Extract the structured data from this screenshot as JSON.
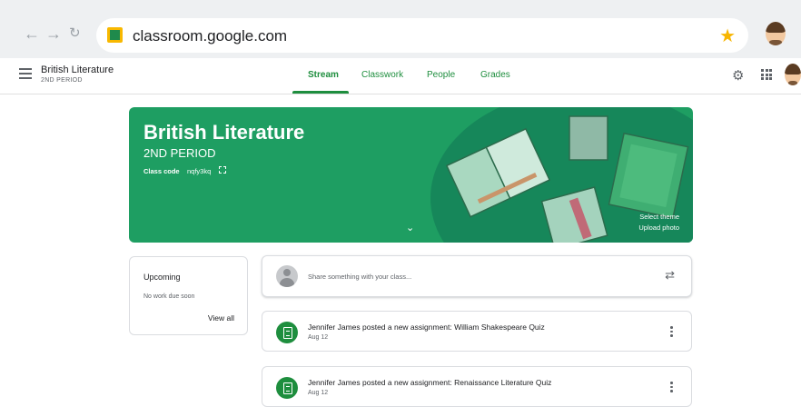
{
  "browser": {
    "url": "classroom.google.com",
    "back_icon": "back-arrow-icon",
    "forward_icon": "forward-arrow-icon",
    "reload_icon": "reload-icon"
  },
  "header": {
    "class_name": "British Literature",
    "class_period": "2ND PERIOD",
    "tabs": [
      {
        "label": "Stream",
        "active": true
      },
      {
        "label": "Classwork",
        "active": false
      },
      {
        "label": "People",
        "active": false
      },
      {
        "label": "Grades",
        "active": false
      }
    ]
  },
  "banner": {
    "title": "British Literature",
    "period": "2ND PERIOD",
    "class_code_label": "Class code",
    "class_code": "nqfy3kq",
    "select_theme": "Select theme",
    "upload_photo": "Upload photo"
  },
  "upcoming": {
    "title": "Upcoming",
    "empty": "No work due soon",
    "view_all": "View all"
  },
  "share": {
    "placeholder": "Share something with your class..."
  },
  "posts": [
    {
      "title": "Jennifer James posted a new assignment: William Shakespeare Quiz",
      "date": "Aug 12"
    },
    {
      "title": "Jennifer James posted a new assignment: Renaissance Literature Quiz",
      "date": "Aug 12"
    }
  ],
  "colors": {
    "accent": "#1e8e3e",
    "banner": "#1e9e62",
    "star": "#f7b500"
  }
}
